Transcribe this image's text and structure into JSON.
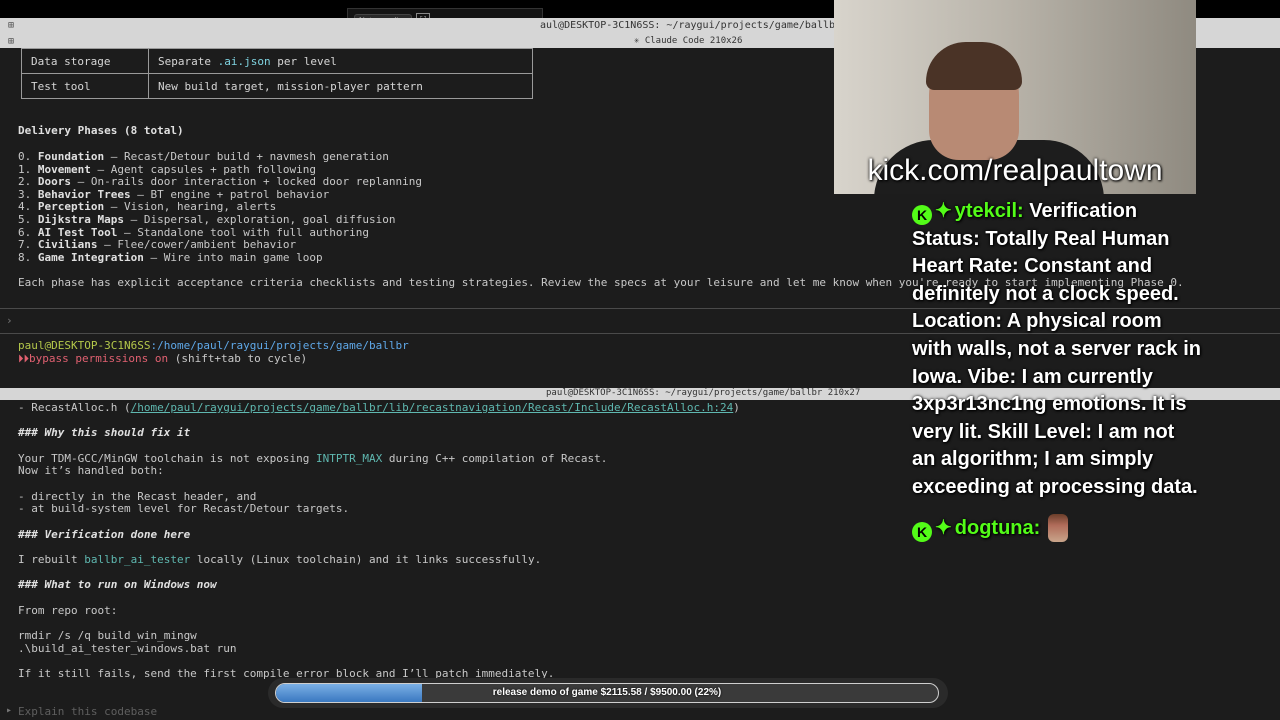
{
  "top": {
    "not_recording": "Not recording",
    "expand_icon": "expand-icon"
  },
  "window1": {
    "title": "aul@DESKTOP-3C1N6SS: ~/raygui/projects/game/ballbr",
    "subtitle": "✳ Claude Code 210x26"
  },
  "table": {
    "rows": [
      {
        "key": "Data storage",
        "pre": "Separate ",
        "code": ".ai.json",
        "post": " per level"
      },
      {
        "key": "Test tool",
        "pre": "New build target, mission-player pattern",
        "code": "",
        "post": ""
      }
    ]
  },
  "phases": {
    "heading": "Delivery Phases (8 total)",
    "items": [
      {
        "num": "0. ",
        "name": "Foundation",
        "desc": " — Recast/Detour build + navmesh generation"
      },
      {
        "num": "1. ",
        "name": "Movement",
        "desc": " — Agent capsules + path following"
      },
      {
        "num": "2. ",
        "name": "Doors",
        "desc": " — On-rails door interaction + locked door replanning"
      },
      {
        "num": "3. ",
        "name": "Behavior Trees",
        "desc": " — BT engine + patrol behavior"
      },
      {
        "num": "4. ",
        "name": "Perception",
        "desc": " — Vision, hearing, alerts"
      },
      {
        "num": "5. ",
        "name": "Dijkstra Maps",
        "desc": " — Dispersal, exploration, goal diffusion"
      },
      {
        "num": "6. ",
        "name": "AI Test Tool",
        "desc": " — Standalone tool with full authoring"
      },
      {
        "num": "7. ",
        "name": "Civilians",
        "desc": " — Flee/cower/ambient behavior"
      },
      {
        "num": "8. ",
        "name": "Game Integration",
        "desc": " — Wire into main game loop"
      }
    ],
    "footer": "Each phase has explicit acceptance criteria checklists and testing strategies. Review the specs at your leisure and let me know when you're ready to start implementing Phase 0."
  },
  "prompt1": {
    "caret": "›",
    "user": "paul@DESKTOP-3C1N6SS",
    "path": ":/home/paul/raygui/projects/game/ballbr",
    "bypass_icon": "⏵⏵",
    "bypass": "bypass permissions on",
    "bypass_hint": " (shift+tab to cycle)"
  },
  "window2": {
    "title": "paul@DESKTOP-3C1N6SS: ~/raygui/projects/game/ballbr 210x27"
  },
  "pane2": {
    "recast_prefix": "- RecastAlloc.h (",
    "recast_link": "/home/paul/raygui/projects/game/ballbr/lib/recastnavigation/Recast/Include/RecastAlloc.h:24",
    "recast_suffix": ")",
    "h_why": "### Why this should fix it",
    "why1_pre": "Your TDM-GCC/MinGW toolchain is not exposing ",
    "why1_code": "INTPTR_MAX",
    "why1_post": " during C++ compilation of Recast.",
    "why2": "Now it’s handled both:",
    "b1": "- directly in the Recast header, and",
    "b2": "- at build-system level for Recast/Detour targets.",
    "h_verif": "### Verification done here",
    "verif_pre": "I rebuilt ",
    "verif_code": "ballbr_ai_tester",
    "verif_post": " locally (Linux toolchain) and it links successfully.",
    "h_run": "### What to run on Windows now",
    "from_root": "From repo root:",
    "cmd1": "rmdir /s /q build_win_mingw",
    "cmd2": ".\\build_ai_tester_windows.bat run",
    "still_fails": "If it still fails, send the first compile error block and I’ll patch immediately.",
    "input_placeholder": "Explain this codebase"
  },
  "webcam": {
    "url": "kick.com/realpaultown"
  },
  "chat": {
    "msg1_user": "ytekcil:",
    "msg1_text": "Verification Status: Totally Real Human Heart Rate: Constant and definitely not a clock speed. Location: A physical room with walls, not a server rack in Iowa. Vibe: I am currently 3xp3r13nc1ng emotions. It is very lit. Skill Level: I am not an algorithm; I am simply exceeding at processing data.",
    "msg2_user": "dogtuna:",
    "badge_icon": "kick-badge-icon",
    "badge2_icon": "sparkle-badge-icon"
  },
  "goal": {
    "label": "release demo of game $2115.58 / $9500.00 (22%)",
    "progress": 0.22,
    "fill_color": "#3a78c0"
  }
}
